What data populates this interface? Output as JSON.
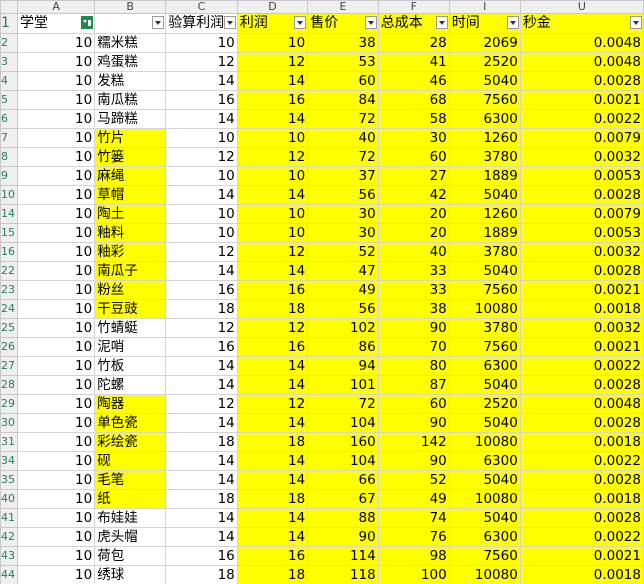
{
  "columns": [
    "A",
    "B",
    "C",
    "D",
    "E",
    "F",
    "I",
    "U"
  ],
  "headers": [
    "学堂",
    "",
    "验算利润",
    "利润",
    "售价",
    "总成本",
    "时间",
    "秒金"
  ],
  "header_row_num": "1",
  "rows": [
    {
      "n": "2",
      "a": "10",
      "b": "糯米糕",
      "c": "10",
      "d": "10",
      "e": "38",
      "f": "28",
      "i": "2069",
      "u": "0.0048",
      "y": false
    },
    {
      "n": "3",
      "a": "10",
      "b": "鸡蛋糕",
      "c": "12",
      "d": "12",
      "e": "53",
      "f": "41",
      "i": "2520",
      "u": "0.0048",
      "y": false
    },
    {
      "n": "4",
      "a": "10",
      "b": "发糕",
      "c": "14",
      "d": "14",
      "e": "60",
      "f": "46",
      "i": "5040",
      "u": "0.0028",
      "y": false
    },
    {
      "n": "5",
      "a": "10",
      "b": "南瓜糕",
      "c": "16",
      "d": "16",
      "e": "84",
      "f": "68",
      "i": "7560",
      "u": "0.0021",
      "y": false
    },
    {
      "n": "6",
      "a": "10",
      "b": "马蹄糕",
      "c": "14",
      "d": "14",
      "e": "72",
      "f": "58",
      "i": "6300",
      "u": "0.0022",
      "y": false
    },
    {
      "n": "7",
      "a": "10",
      "b": "竹片",
      "c": "10",
      "d": "10",
      "e": "40",
      "f": "30",
      "i": "1260",
      "u": "0.0079",
      "y": true
    },
    {
      "n": "8",
      "a": "10",
      "b": "竹篓",
      "c": "12",
      "d": "12",
      "e": "72",
      "f": "60",
      "i": "3780",
      "u": "0.0032",
      "y": true
    },
    {
      "n": "9",
      "a": "10",
      "b": "麻绳",
      "c": "10",
      "d": "10",
      "e": "37",
      "f": "27",
      "i": "1889",
      "u": "0.0053",
      "y": true
    },
    {
      "n": "10",
      "a": "10",
      "b": "草帽",
      "c": "14",
      "d": "14",
      "e": "56",
      "f": "42",
      "i": "5040",
      "u": "0.0028",
      "y": true
    },
    {
      "n": "14",
      "a": "10",
      "b": "陶土",
      "c": "10",
      "d": "10",
      "e": "30",
      "f": "20",
      "i": "1260",
      "u": "0.0079",
      "y": true
    },
    {
      "n": "15",
      "a": "10",
      "b": "釉料",
      "c": "10",
      "d": "10",
      "e": "30",
      "f": "20",
      "i": "1889",
      "u": "0.0053",
      "y": true
    },
    {
      "n": "16",
      "a": "10",
      "b": "釉彩",
      "c": "12",
      "d": "12",
      "e": "52",
      "f": "40",
      "i": "3780",
      "u": "0.0032",
      "y": true
    },
    {
      "n": "22",
      "a": "10",
      "b": "南瓜子",
      "c": "14",
      "d": "14",
      "e": "47",
      "f": "33",
      "i": "5040",
      "u": "0.0028",
      "y": true
    },
    {
      "n": "23",
      "a": "10",
      "b": "粉丝",
      "c": "16",
      "d": "16",
      "e": "49",
      "f": "33",
      "i": "7560",
      "u": "0.0021",
      "y": true
    },
    {
      "n": "24",
      "a": "10",
      "b": "干豆豉",
      "c": "18",
      "d": "18",
      "e": "56",
      "f": "38",
      "i": "10080",
      "u": "0.0018",
      "y": true
    },
    {
      "n": "25",
      "a": "10",
      "b": "竹蜻蜓",
      "c": "12",
      "d": "12",
      "e": "102",
      "f": "90",
      "i": "3780",
      "u": "0.0032",
      "y": false
    },
    {
      "n": "26",
      "a": "10",
      "b": "泥哨",
      "c": "16",
      "d": "16",
      "e": "86",
      "f": "70",
      "i": "7560",
      "u": "0.0021",
      "y": false
    },
    {
      "n": "27",
      "a": "10",
      "b": "竹板",
      "c": "14",
      "d": "14",
      "e": "94",
      "f": "80",
      "i": "6300",
      "u": "0.0022",
      "y": false
    },
    {
      "n": "28",
      "a": "10",
      "b": "陀螺",
      "c": "14",
      "d": "14",
      "e": "101",
      "f": "87",
      "i": "5040",
      "u": "0.0028",
      "y": false
    },
    {
      "n": "29",
      "a": "10",
      "b": "陶器",
      "c": "12",
      "d": "12",
      "e": "72",
      "f": "60",
      "i": "2520",
      "u": "0.0048",
      "y": true
    },
    {
      "n": "30",
      "a": "10",
      "b": "单色瓷",
      "c": "14",
      "d": "14",
      "e": "104",
      "f": "90",
      "i": "5040",
      "u": "0.0028",
      "y": true
    },
    {
      "n": "31",
      "a": "10",
      "b": "彩绘瓷",
      "c": "18",
      "d": "18",
      "e": "160",
      "f": "142",
      "i": "10080",
      "u": "0.0018",
      "y": true
    },
    {
      "n": "34",
      "a": "10",
      "b": "砚",
      "c": "14",
      "d": "14",
      "e": "104",
      "f": "90",
      "i": "6300",
      "u": "0.0022",
      "y": true
    },
    {
      "n": "35",
      "a": "10",
      "b": "毛笔",
      "c": "14",
      "d": "14",
      "e": "66",
      "f": "52",
      "i": "5040",
      "u": "0.0028",
      "y": true
    },
    {
      "n": "40",
      "a": "10",
      "b": "纸",
      "c": "18",
      "d": "18",
      "e": "67",
      "f": "49",
      "i": "10080",
      "u": "0.0018",
      "y": true
    },
    {
      "n": "41",
      "a": "10",
      "b": "布娃娃",
      "c": "14",
      "d": "14",
      "e": "88",
      "f": "74",
      "i": "5040",
      "u": "0.0028",
      "y": false
    },
    {
      "n": "42",
      "a": "10",
      "b": "虎头帽",
      "c": "14",
      "d": "14",
      "e": "90",
      "f": "76",
      "i": "6300",
      "u": "0.0022",
      "y": false
    },
    {
      "n": "43",
      "a": "10",
      "b": "荷包",
      "c": "16",
      "d": "16",
      "e": "114",
      "f": "98",
      "i": "7560",
      "u": "0.0021",
      "y": false
    },
    {
      "n": "44",
      "a": "10",
      "b": "绣球",
      "c": "18",
      "d": "18",
      "e": "118",
      "f": "100",
      "i": "10080",
      "u": "0.0018",
      "y": false
    }
  ],
  "colors": {
    "highlight": "#ffff00",
    "filter_active": "#1e8a4f",
    "grid": "#d4d4d4",
    "header_bg": "#efefef"
  }
}
